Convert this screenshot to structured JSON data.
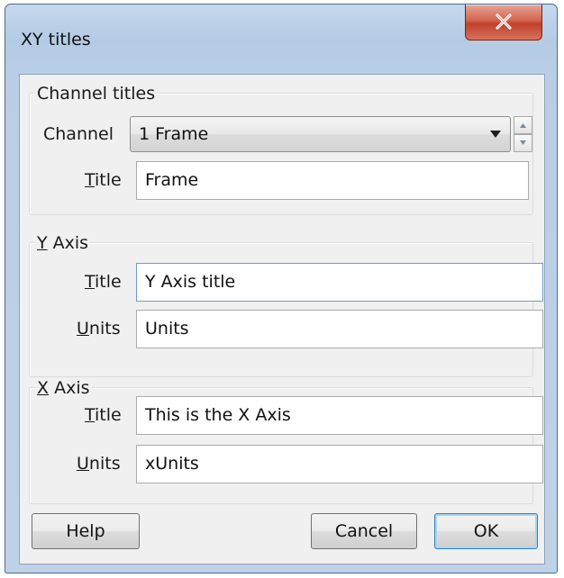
{
  "window": {
    "title": "XY titles"
  },
  "channel_group": {
    "label": "Channel titles",
    "channel_label": "Channel",
    "channel_value": "1 Frame",
    "title_label": "Title",
    "title_value": "Frame"
  },
  "y_axis": {
    "label": "Y Axis",
    "title_label": "Title",
    "title_value": "Y Axis title",
    "units_label": "Units",
    "units_value": "Units"
  },
  "x_axis": {
    "label": "X Axis",
    "title_label": "Title",
    "title_value": "This is the X Axis",
    "units_label": "Units",
    "units_value": "xUnits"
  },
  "buttons": {
    "help": "Help",
    "cancel": "Cancel",
    "ok": "OK"
  },
  "icons": {
    "close": "close-icon",
    "dropdown": "chevron-down-icon",
    "spin_up": "spin-up-icon",
    "spin_down": "spin-down-icon"
  },
  "colors": {
    "title_bar": "#b9cfe6",
    "close_button": "#c9533d",
    "dialog_bg": "#f0f0f0",
    "focus_border": "#6f9ccd",
    "default_button_border": "#3c7fb1"
  }
}
